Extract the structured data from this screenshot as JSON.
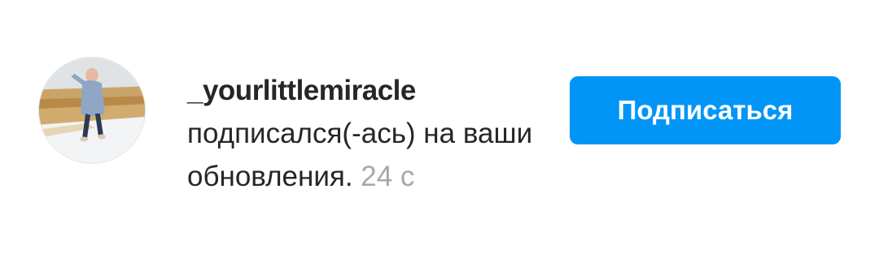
{
  "notification": {
    "username": "_yourlittlemiracle",
    "message": "подписался(-ась) на ваши обновления.",
    "timestamp": "24 с",
    "follow_label": "Подписаться"
  },
  "colors": {
    "button": "#0095f6",
    "text": "#262626",
    "timestamp": "#a8a8a8"
  }
}
